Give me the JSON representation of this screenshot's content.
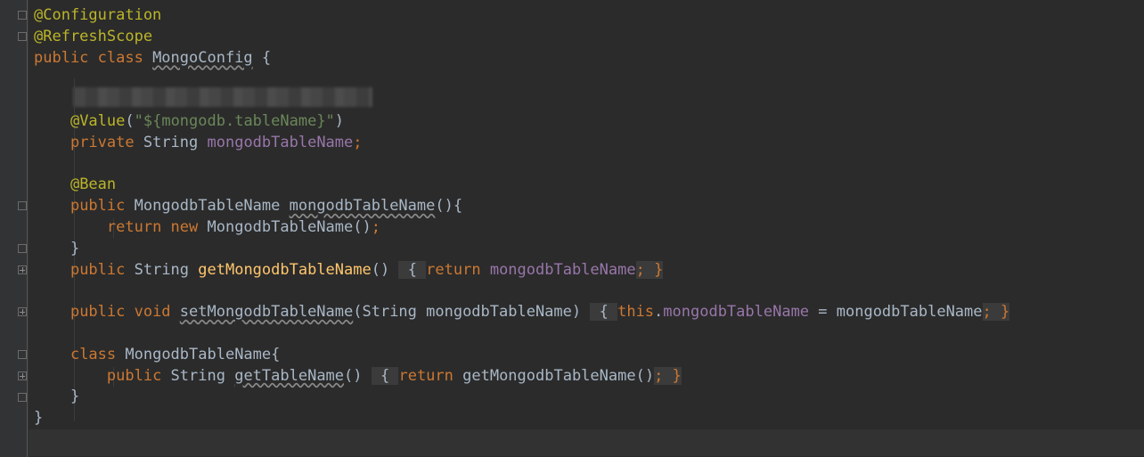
{
  "editor": {
    "lines": [
      {
        "segments": [
          {
            "t": "@Configuration",
            "c": "ann"
          }
        ]
      },
      {
        "segments": [
          {
            "t": "@RefreshScope",
            "c": "ann"
          }
        ]
      },
      {
        "segments": [
          {
            "t": "public class ",
            "c": "kw"
          },
          {
            "t": "MongoConfig",
            "c": "txt sq"
          },
          {
            "t": " {",
            "c": "txt"
          }
        ]
      },
      {
        "segments": []
      },
      {
        "segments": []
      },
      {
        "segments": [
          {
            "t": "    ",
            "c": "txt"
          },
          {
            "t": "@Value",
            "c": "ann"
          },
          {
            "t": "(",
            "c": "txt"
          },
          {
            "t": "\"${mongodb.tableName}\"",
            "c": "str"
          },
          {
            "t": ")",
            "c": "txt"
          }
        ]
      },
      {
        "segments": [
          {
            "t": "    ",
            "c": "txt"
          },
          {
            "t": "private ",
            "c": "kw"
          },
          {
            "t": "String ",
            "c": "txt"
          },
          {
            "t": "mongodbTableName",
            "c": "fld"
          },
          {
            "t": ";",
            "c": "kw"
          }
        ]
      },
      {
        "segments": []
      },
      {
        "segments": [
          {
            "t": "    ",
            "c": "txt"
          },
          {
            "t": "@Bean",
            "c": "ann"
          }
        ]
      },
      {
        "segments": [
          {
            "t": "    ",
            "c": "txt"
          },
          {
            "t": "public ",
            "c": "kw"
          },
          {
            "t": "MongodbTableName ",
            "c": "txt"
          },
          {
            "t": "mongodbTableName",
            "c": "txt sq"
          },
          {
            "t": "(){",
            "c": "txt"
          }
        ]
      },
      {
        "segments": [
          {
            "t": "        ",
            "c": "txt"
          },
          {
            "t": "return new ",
            "c": "kw"
          },
          {
            "t": "MongodbTableName()",
            "c": "txt"
          },
          {
            "t": ";",
            "c": "kw"
          }
        ]
      },
      {
        "segments": [
          {
            "t": "    }",
            "c": "txt"
          }
        ]
      },
      {
        "segments": [
          {
            "t": "    ",
            "c": "txt"
          },
          {
            "t": "public ",
            "c": "kw"
          },
          {
            "t": "String ",
            "c": "txt"
          },
          {
            "t": "getMongodbTableName",
            "c": "meth"
          },
          {
            "t": "() ",
            "c": "txt"
          },
          {
            "t": " { ",
            "c": "txt fold"
          },
          {
            "t": "return ",
            "c": "kw"
          },
          {
            "t": "mongodbTableName",
            "c": "fld"
          },
          {
            "t": "; }",
            "c": "kw fold"
          }
        ]
      },
      {
        "segments": []
      },
      {
        "segments": [
          {
            "t": "    ",
            "c": "txt"
          },
          {
            "t": "public void ",
            "c": "kw"
          },
          {
            "t": "setMongodbTableName",
            "c": "txt sq"
          },
          {
            "t": "(String mongodbTableName) ",
            "c": "txt"
          },
          {
            "t": " { ",
            "c": "txt fold"
          },
          {
            "t": "this",
            "c": "kw"
          },
          {
            "t": ".",
            "c": "txt"
          },
          {
            "t": "mongodbTableName",
            "c": "fld"
          },
          {
            "t": " = mongodbTableName",
            "c": "txt"
          },
          {
            "t": "; }",
            "c": "kw fold"
          }
        ]
      },
      {
        "segments": []
      },
      {
        "segments": [
          {
            "t": "    ",
            "c": "txt"
          },
          {
            "t": "class ",
            "c": "kw"
          },
          {
            "t": "MongodbTableName{",
            "c": "txt"
          }
        ]
      },
      {
        "segments": [
          {
            "t": "        ",
            "c": "txt"
          },
          {
            "t": "public ",
            "c": "kw"
          },
          {
            "t": "String ",
            "c": "txt"
          },
          {
            "t": "getTableName",
            "c": "txt sq"
          },
          {
            "t": "() ",
            "c": "txt"
          },
          {
            "t": " { ",
            "c": "txt fold"
          },
          {
            "t": "return ",
            "c": "kw"
          },
          {
            "t": "getMongodbTableName()",
            "c": "txt"
          },
          {
            "t": "; }",
            "c": "kw fold"
          }
        ]
      },
      {
        "segments": [
          {
            "t": "    }",
            "c": "txt"
          }
        ]
      },
      {
        "segments": [
          {
            "t": "}",
            "c": "txt"
          }
        ]
      }
    ]
  },
  "colors": {
    "background": "#2b2b2b",
    "gutter": "#313335",
    "annotation": "#bbb529",
    "keyword": "#cc7832",
    "field": "#9876aa",
    "string": "#6a8759",
    "method": "#ffc66d",
    "text": "#a9b7c6"
  }
}
